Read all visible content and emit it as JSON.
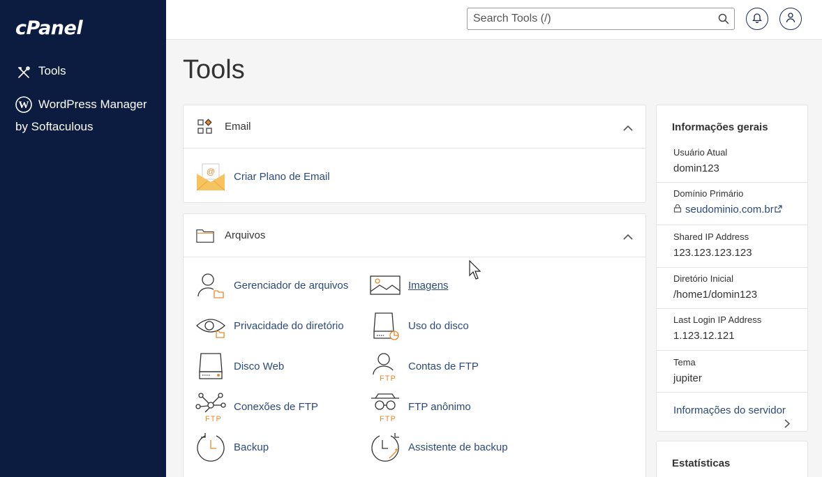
{
  "sidebar": {
    "logo": "cPanel",
    "items": [
      {
        "label": "Tools",
        "icon": "tools-icon"
      },
      {
        "label_line1": "WordPress Manager",
        "label_line2": "by Softaculous",
        "icon": "wordpress-icon"
      }
    ]
  },
  "topbar": {
    "search_placeholder": "Search Tools (/)"
  },
  "page": {
    "title": "Tools"
  },
  "email_section": {
    "title": "Email",
    "tools": [
      {
        "label": "Criar Plano de Email",
        "icon": "email-plan-icon"
      }
    ]
  },
  "files_section": {
    "title": "Arquivos",
    "tools": [
      {
        "label": "Gerenciador de arquivos",
        "icon": "file-manager-icon"
      },
      {
        "label": "Imagens",
        "icon": "images-icon"
      },
      {
        "label": "Privacidade do diretório",
        "icon": "directory-privacy-icon"
      },
      {
        "label": "Uso do disco",
        "icon": "disk-usage-icon"
      },
      {
        "label": "Disco Web",
        "icon": "web-disk-icon"
      },
      {
        "label": "Contas de FTP",
        "icon": "ftp-accounts-icon"
      },
      {
        "label": "Conexões de FTP",
        "icon": "ftp-connections-icon"
      },
      {
        "label": "FTP anônimo",
        "icon": "anonymous-ftp-icon"
      },
      {
        "label": "Backup",
        "icon": "backup-icon"
      },
      {
        "label": "Assistente de backup",
        "icon": "backup-wizard-icon"
      }
    ]
  },
  "general_info": {
    "title": "Informações gerais",
    "rows": [
      {
        "label": "Usuário Atual",
        "value": "domin123"
      },
      {
        "label": "Domínio Primário",
        "value": "seudominio.com.br"
      },
      {
        "label": "Shared IP Address",
        "value": "123.123.123.123"
      },
      {
        "label": "Diretório Inicial",
        "value": "/home1/domin123"
      },
      {
        "label": "Last Login IP Address",
        "value": "1.123.12.121"
      },
      {
        "label": "Tema",
        "value": "jupiter"
      }
    ],
    "server_info_link": "Informações do servidor"
  },
  "stats": {
    "title": "Estatísticas"
  },
  "colors": {
    "sidebar_bg": "#0c1b40",
    "link": "#2b4a7a",
    "accent_orange": "#e8892b"
  }
}
